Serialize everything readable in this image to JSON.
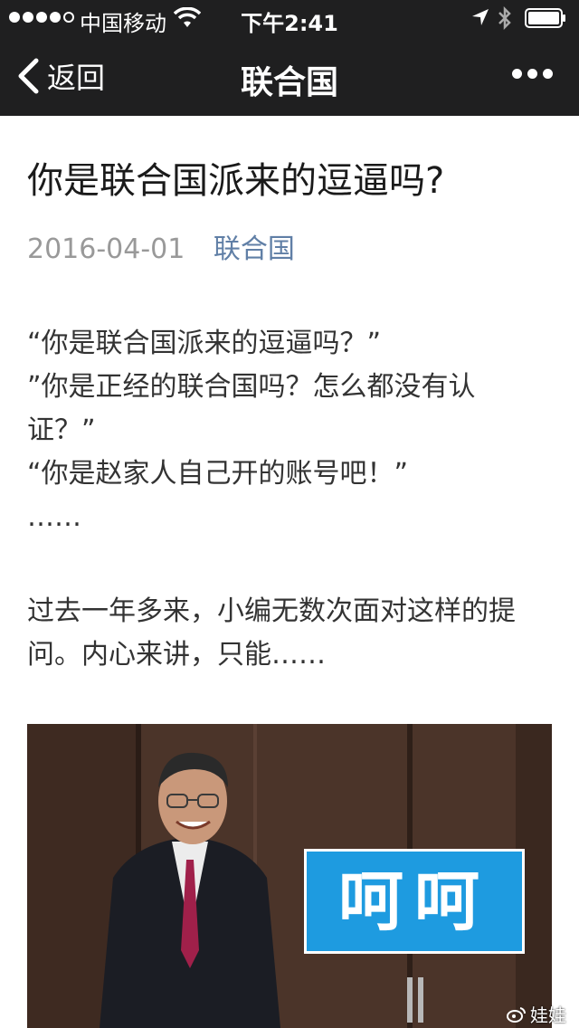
{
  "status_bar": {
    "carrier": "中国移动",
    "time": "下午2:41"
  },
  "nav": {
    "back_label": "返回",
    "title": "联合国"
  },
  "article": {
    "headline": "你是联合国派来的逗逼吗?",
    "date": "2016-04-01",
    "account": "联合国",
    "paragraph1_lines": [
      "“你是联合国派来的逗逼吗？”",
      "”你是正经的联合国吗？怎么都没有认",
      "证？”",
      "“你是赵家人自己开的账号吧！”",
      "……"
    ],
    "paragraph2_lines": [
      "过去一年多来，小编无数次面对这样的提",
      "问。内心来讲，只能……"
    ],
    "image_caption": "呵呵"
  },
  "watermark": {
    "text": "娃娃"
  },
  "colors": {
    "nav_bg": "#1f1f20",
    "link": "#607fa6",
    "meta_gray": "#999999",
    "caption_blue": "#1e9be0"
  },
  "icons": [
    "wifi-icon",
    "location-icon",
    "bluetooth-icon",
    "battery-icon",
    "back-chevron-icon",
    "more-icon",
    "weibo-icon"
  ]
}
